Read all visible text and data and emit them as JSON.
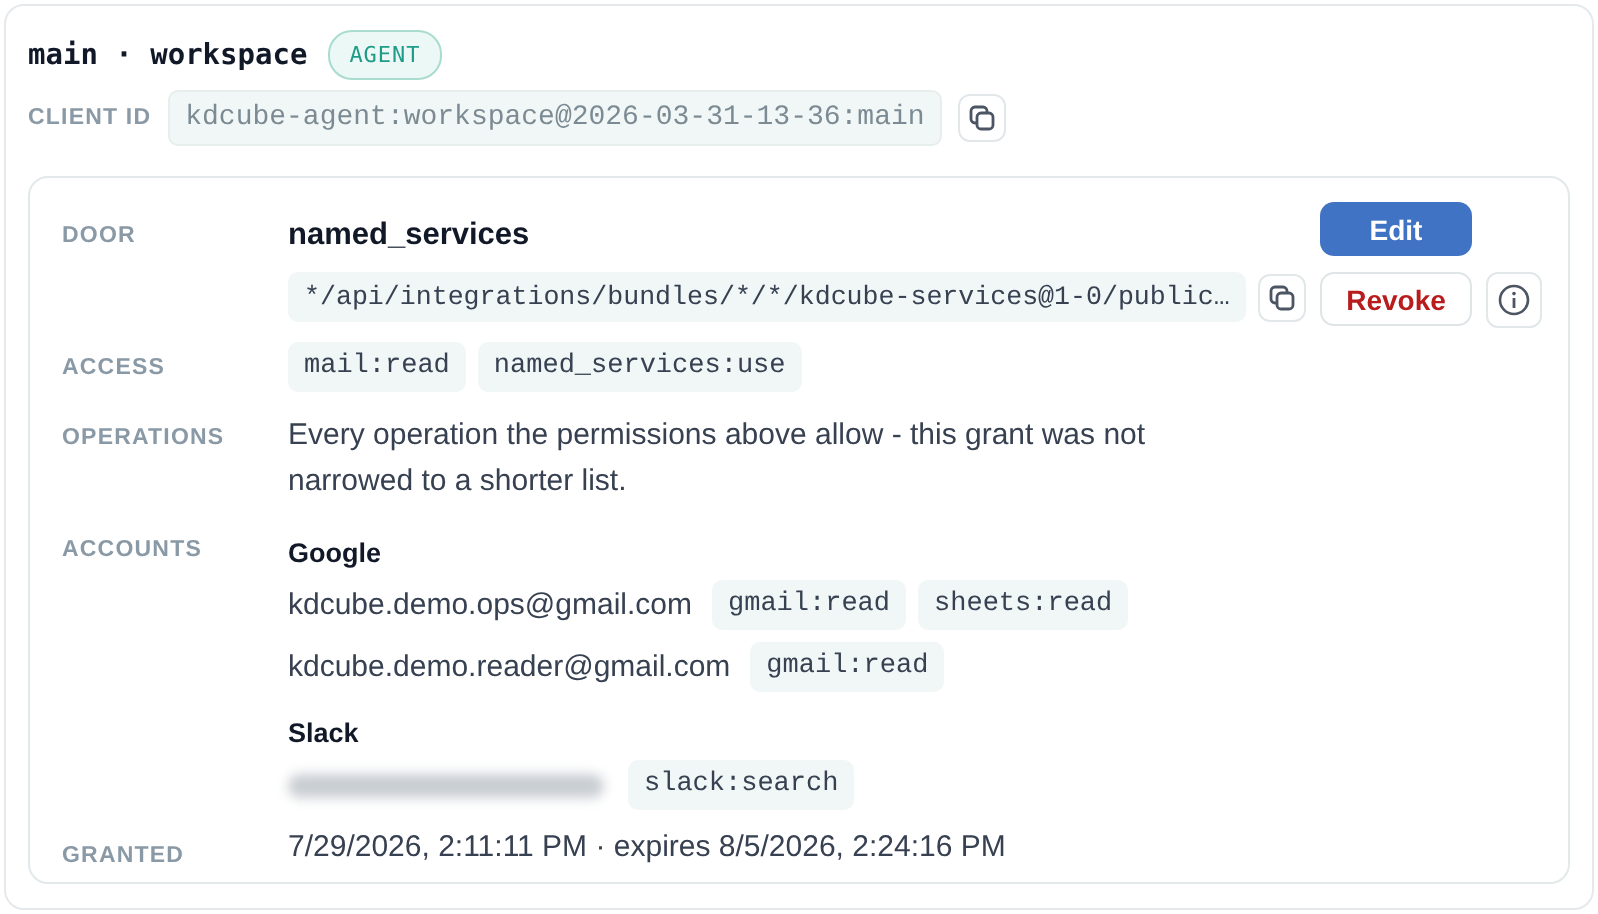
{
  "header": {
    "title": "main · workspace",
    "badge": "AGENT",
    "client_id_label": "CLIENT ID",
    "client_id": "kdcube-agent:workspace@2026-03-31-13-36:main"
  },
  "grant": {
    "door_label": "DOOR",
    "door_name": "named_services",
    "door_path": "*/api/integrations/bundles/*/*/kdcube-services@1-0/public…",
    "buttons": [
      {
        "label": "Edit",
        "kind": "primary"
      },
      {
        "label": "Revoke",
        "kind": "danger"
      }
    ],
    "access_label": "ACCESS",
    "access": [
      "mail:read",
      "named_services:use"
    ],
    "operations_label": "OPERATIONS",
    "operations": "Every operation the permissions above allow - this grant was not narrowed to a shorter list.",
    "accounts_label": "ACCOUNTS",
    "providers": [
      {
        "name": "Google",
        "accounts": [
          {
            "email": "kdcube.demo.ops@gmail.com",
            "redacted": false,
            "scopes": [
              "gmail:read",
              "sheets:read"
            ]
          },
          {
            "email": "kdcube.demo.reader@gmail.com",
            "redacted": false,
            "scopes": [
              "gmail:read"
            ]
          }
        ]
      },
      {
        "name": "Slack",
        "accounts": [
          {
            "redacted": true,
            "scopes": [
              "slack:search"
            ]
          }
        ]
      }
    ],
    "granted_label": "GRANTED",
    "granted": "7/29/2026, 2:11:11 PM · expires 8/5/2026, 2:24:16 PM"
  }
}
